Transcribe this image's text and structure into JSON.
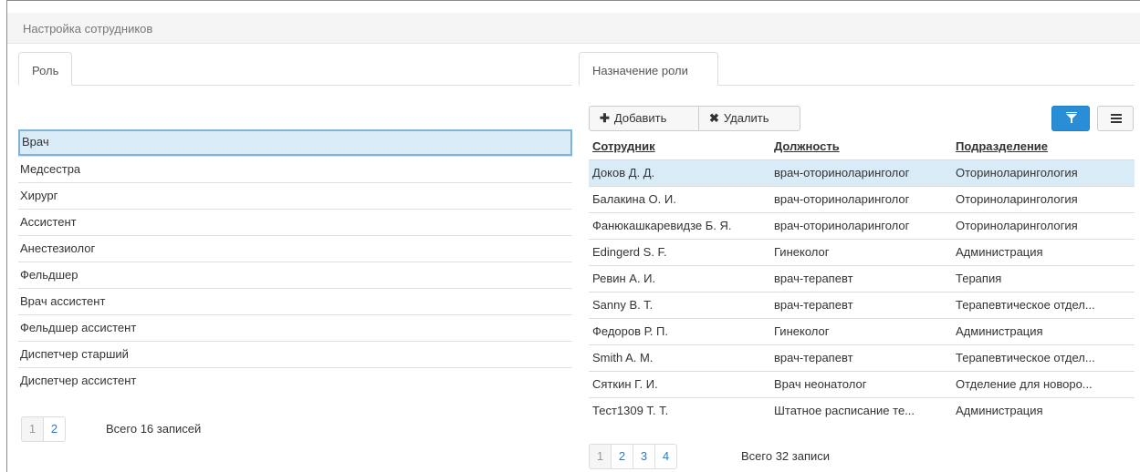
{
  "panel": {
    "title": "Настройка сотрудников"
  },
  "left": {
    "tab": "Роль",
    "roles": [
      "Врач",
      "Медсестра",
      "Хирург",
      "Ассистент",
      "Анестезиолог",
      "Фельдшер",
      "Врач ассистент",
      "Фельдшер ассистент",
      "Диспетчер старший",
      "Диспетчер ассистент"
    ],
    "selected_index": 0,
    "pages": [
      "1",
      "2"
    ],
    "active_page": "1",
    "total": "Всего 16 записей"
  },
  "right": {
    "tab": "Назначение роли",
    "toolbar": {
      "add_label": "Добавить",
      "delete_label": "Удалить"
    },
    "columns": [
      "Сотрудник",
      "Должность",
      "Подразделение"
    ],
    "rows": [
      [
        "Доков Д. Д.",
        "врач-оториноларинголог",
        "Оториноларингология"
      ],
      [
        "Балакина О. И.",
        "врач-оториноларинголог",
        "Оториноларингология"
      ],
      [
        "Фанюкашкаревидзе Б. Я.",
        "врач-оториноларинголог",
        "Оториноларингология"
      ],
      [
        "Edingerd S. F.",
        "Гинеколог",
        "Администрация"
      ],
      [
        "Ревин А. И.",
        "врач-терапевт",
        "Терапия"
      ],
      [
        "Sanny B. T.",
        "врач-терапевт",
        "Терапевтическое отдел..."
      ],
      [
        "Федоров Р. П.",
        "Гинеколог",
        "Администрация"
      ],
      [
        "Smith A. M.",
        "врач-терапевт",
        "Терапевтическое отдел..."
      ],
      [
        "Сяткин Г. И.",
        "Врач неонатолог",
        "Отделение для новоро..."
      ],
      [
        "Тест1309 Т. Т.",
        "Штатное расписание те...",
        "Администрация"
      ]
    ],
    "selected_row": 0,
    "pages": [
      "1",
      "2",
      "3",
      "4"
    ],
    "active_page": "1",
    "total": "Всего 32 записи"
  },
  "icons": {
    "add": "plus-icon",
    "delete": "cross-icon",
    "filter": "funnel-icon",
    "menu": "hamburger-icon"
  },
  "colors": {
    "accent": "#2a8ed6",
    "selection": "#d9ebf7",
    "link": "#337ab7"
  }
}
